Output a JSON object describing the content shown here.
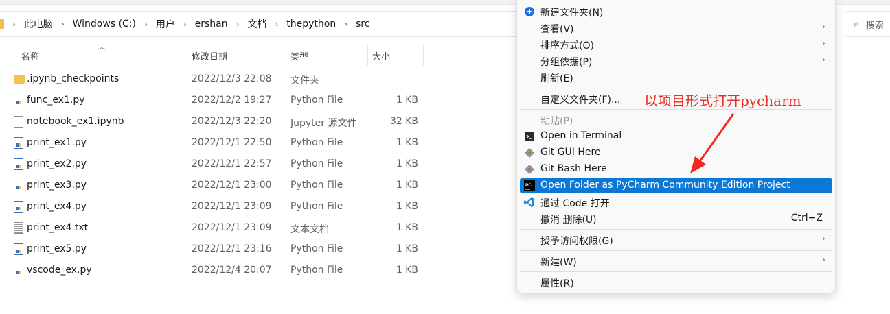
{
  "breadcrumb": [
    "此电脑",
    "Windows (C:)",
    "用户",
    "ershan",
    "文档",
    "thepython",
    "src"
  ],
  "search": {
    "placeholder": "搜索"
  },
  "columns": {
    "name": "名称",
    "date": "修改日期",
    "type": "类型",
    "size": "大小"
  },
  "files": [
    {
      "name": ".ipynb_checkpoints",
      "date": "2022/12/3 22:08",
      "type": "文件夹",
      "size": "",
      "kind": "folder"
    },
    {
      "name": "func_ex1.py",
      "date": "2022/12/2 19:27",
      "type": "Python File",
      "size": "1 KB",
      "kind": "py"
    },
    {
      "name": "notebook_ex1.ipynb",
      "date": "2022/12/3 22:20",
      "type": "Jupyter 源文件",
      "size": "32 KB",
      "kind": "file"
    },
    {
      "name": "print_ex1.py",
      "date": "2022/12/1 22:50",
      "type": "Python File",
      "size": "1 KB",
      "kind": "py"
    },
    {
      "name": "print_ex2.py",
      "date": "2022/12/1 22:57",
      "type": "Python File",
      "size": "1 KB",
      "kind": "py"
    },
    {
      "name": "print_ex3.py",
      "date": "2022/12/1 23:00",
      "type": "Python File",
      "size": "1 KB",
      "kind": "py"
    },
    {
      "name": "print_ex4.py",
      "date": "2022/12/1 23:09",
      "type": "Python File",
      "size": "1 KB",
      "kind": "py"
    },
    {
      "name": "print_ex4.txt",
      "date": "2022/12/1 23:09",
      "type": "文本文档",
      "size": "1 KB",
      "kind": "txt"
    },
    {
      "name": "print_ex5.py",
      "date": "2022/12/1 23:16",
      "type": "Python File",
      "size": "1 KB",
      "kind": "py"
    },
    {
      "name": "vscode_ex.py",
      "date": "2022/12/4 20:07",
      "type": "Python File",
      "size": "1 KB",
      "kind": "py"
    }
  ],
  "context_menu": {
    "new_folder": "新建文件夹(N)",
    "view": "查看(V)",
    "sort_by": "排序方式(O)",
    "group_by": "分组依据(P)",
    "refresh": "刷新(E)",
    "customize": "自定义文件夹(F)...",
    "paste": "粘贴(P)",
    "open_terminal": "Open in Terminal",
    "git_gui": "Git GUI Here",
    "git_bash": "Git Bash Here",
    "pycharm": "Open Folder as PyCharm Community Edition Project",
    "vscode": "通过 Code 打开",
    "undo_delete": "撤消 删除(U)",
    "undo_shortcut": "Ctrl+Z",
    "grant_access": "授予访问权限(G)",
    "new": "新建(W)",
    "properties": "属性(R)"
  },
  "annotation": "以项目形式打开pycharm",
  "colors": {
    "highlight": "#0a78d4",
    "annotation": "#f0281f",
    "folder": "#f4c34d"
  }
}
